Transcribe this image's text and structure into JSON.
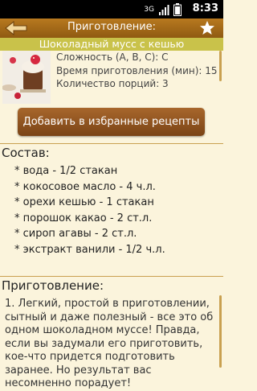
{
  "status": {
    "time": "8:33",
    "network": "3G"
  },
  "header": {
    "title": "Приготовление:"
  },
  "recipe": {
    "name": "Шоколадный мусс с кешью",
    "complexity": "Сложность (A, B, C): C",
    "prep_time": "Время приготовления (мин): 15",
    "servings": "Количество порций: 3"
  },
  "favorite_button": "Добавить в избранные рецепты",
  "ingredients_title": "Состав:",
  "ingredients": [
    "* вода - 1/2 стакан",
    "* кокосовое масло - 4 ч.л.",
    "* орехи кешью - 1 стакан",
    "* порошок какао - 2 ст.л.",
    "* сироп агавы - 2 ст.л.",
    "* экстракт ванили - 1/2 ч.л."
  ],
  "instructions_title": "Приготовление:",
  "instructions_text": "1. Легкий, простой в приготовлении, сытный и даже полезный - все это об одном шоколадном муссе! Правда, если вы задумали его приготовить, кое-что придется подготовить заранее. Но результат вас несомненно порадует!"
}
